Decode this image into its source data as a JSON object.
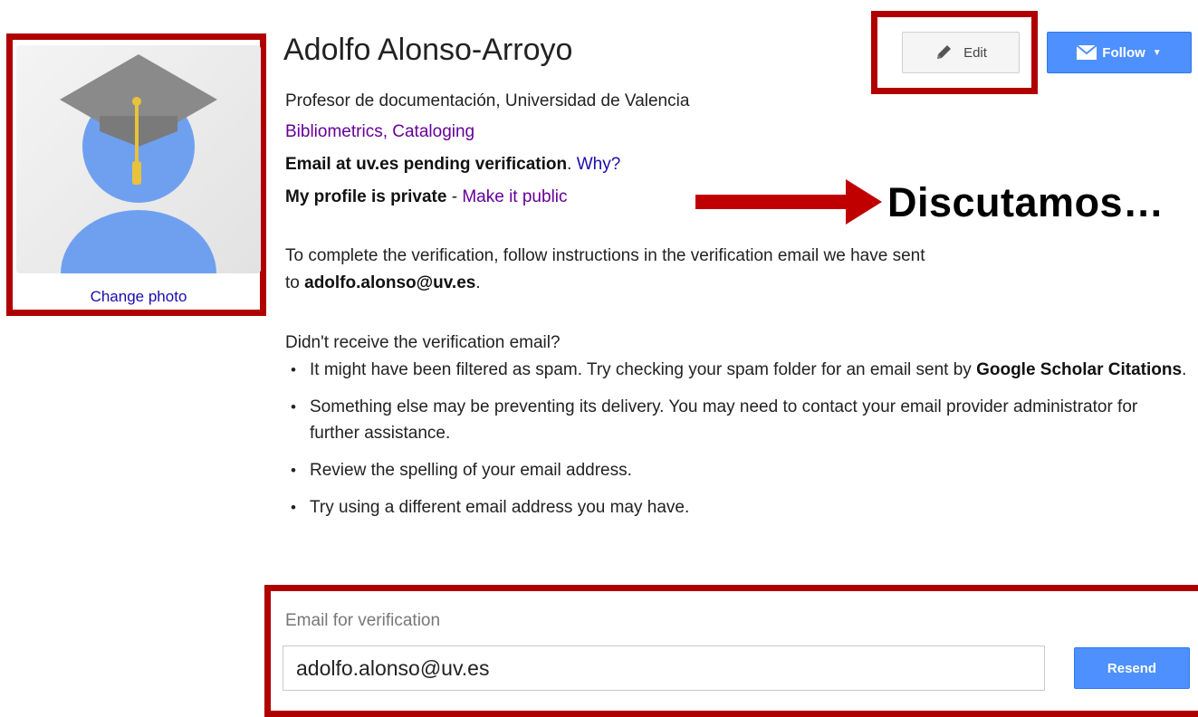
{
  "profile": {
    "name": "Adolfo Alonso-Arroyo",
    "affiliation": "Profesor de documentación, Universidad de Valencia",
    "interests": [
      "Bibliometrics",
      "Cataloging"
    ],
    "interests_separator": ", ",
    "email_status_bold": "Email at uv.es pending verification",
    "email_status_suffix": ".",
    "why_link": "Why?",
    "privacy_bold": "My profile is private",
    "privacy_sep": " - ",
    "make_public_link": "Make it public",
    "change_photo": "Change photo"
  },
  "toolbar": {
    "edit_label": "Edit",
    "follow_label": "Follow",
    "edit_icon": "pencil-icon",
    "follow_icon": "mail-icon"
  },
  "annotation": {
    "text": "Discutamos…",
    "color": "#c00000"
  },
  "verification": {
    "instructions_prefix": "To complete the verification, follow instructions in the verification email we have sent",
    "instructions_to": "to ",
    "email": "adolfo.alonso@uv.es",
    "instructions_suffix": ".",
    "not_received": "Didn't receive the verification email?",
    "tips": [
      {
        "pre": "It might have been filtered as spam. Try checking your spam folder for an email sent by ",
        "bold": "Google Scholar Citations",
        "post": "."
      },
      {
        "pre": "Something else may be preventing its delivery. You may need to contact your email provider administrator for further assistance.",
        "bold": "",
        "post": ""
      },
      {
        "pre": "Review the spelling of your email address.",
        "bold": "",
        "post": ""
      },
      {
        "pre": "Try using a different email address you may have.",
        "bold": "",
        "post": ""
      }
    ],
    "field_label": "Email for verification",
    "field_value": "adolfo.alonso@uv.es",
    "resend_label": "Resend"
  },
  "colors": {
    "highlight_frame": "#b00000",
    "link": "#660099",
    "primary_button": "#4d90fe"
  }
}
